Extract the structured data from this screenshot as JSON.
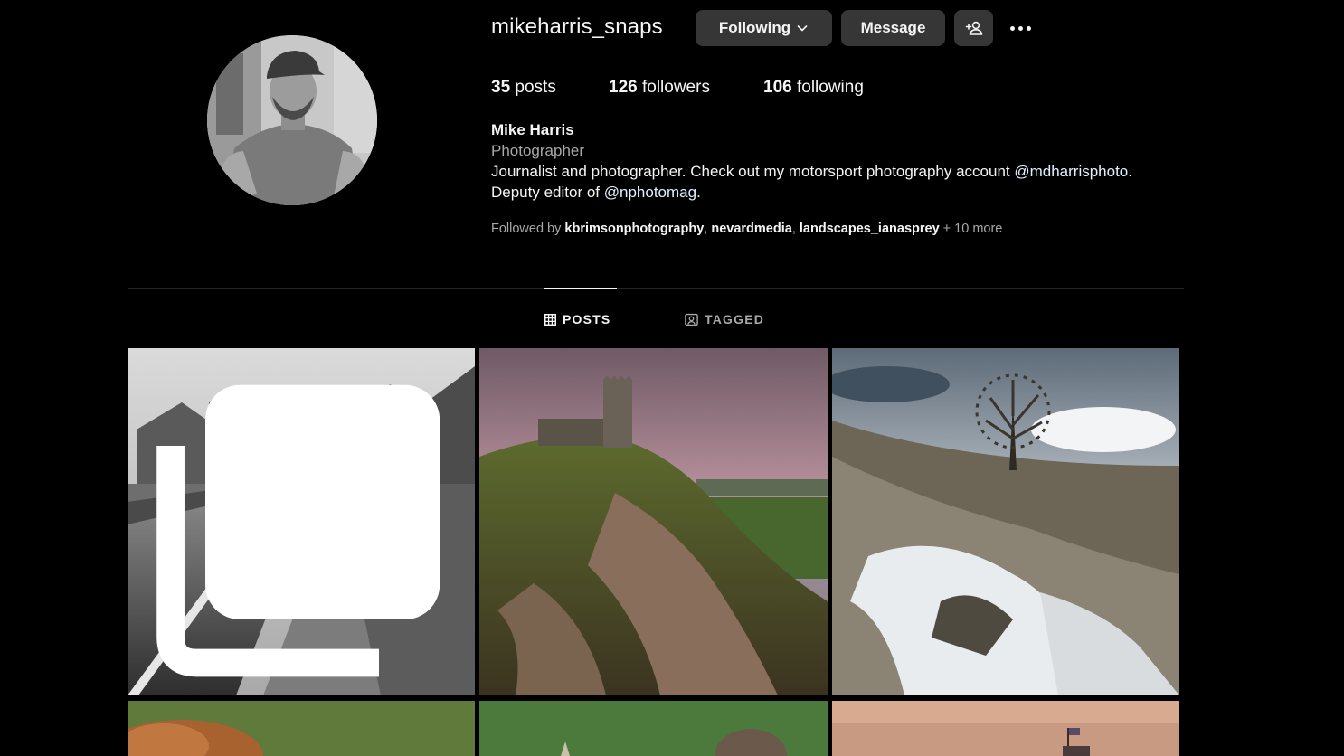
{
  "profile": {
    "username": "mikeharris_snaps",
    "following_label": "Following",
    "message_label": "Message",
    "stats": {
      "posts_count": "35",
      "posts_label": " posts",
      "followers_count": "126",
      "followers_label": " followers",
      "following_count": "106",
      "following_label": " following"
    },
    "name": "Mike Harris",
    "category": "Photographer",
    "bio_line1_text": "Journalist and photographer. Check out my motorsport photography account ",
    "bio_line1_mention": "@mdharrisphoto",
    "bio_line1_end": ".",
    "bio_line2_text": "Deputy editor of ",
    "bio_line2_mention": "@nphotomag",
    "bio_line2_end": ".",
    "followed_by_prefix": "Followed by ",
    "followed_by_users": [
      "kbrimsonphotography",
      "nevardmedia",
      "landscapes_ianasprey"
    ],
    "followed_by_more": " + 10 more"
  },
  "tabs": [
    {
      "label": "POSTS",
      "icon": "grid-icon",
      "active": true
    },
    {
      "label": "TAGGED",
      "icon": "tagged-icon",
      "active": false
    }
  ],
  "posts": [
    {
      "subject": "black and white village street with stone bridge",
      "multiple": true
    },
    {
      "subject": "church on rocky hill at dusk",
      "multiple": false
    },
    {
      "subject": "lone tree on snowy hillside",
      "multiple": false
    },
    {
      "subject": "brown animal on green background",
      "multiple": false
    },
    {
      "subject": "bird on green background",
      "multiple": false
    },
    {
      "subject": "tower with flag at sunset",
      "multiple": false
    }
  ],
  "colors": {
    "background": "#000000",
    "button": "#363636",
    "secondary_text": "#a8a8a8",
    "mention": "#e0f1ff"
  }
}
